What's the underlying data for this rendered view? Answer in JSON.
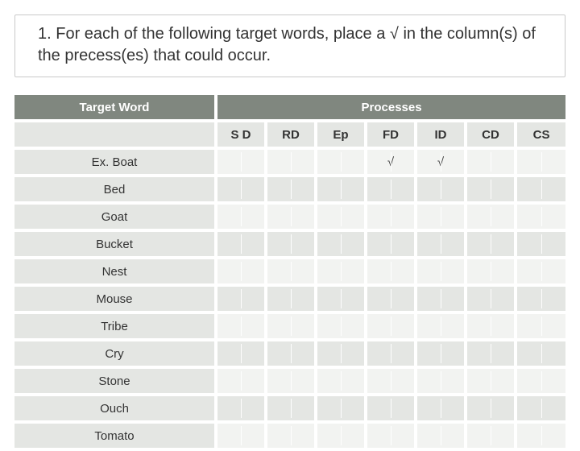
{
  "prompt": "1. For each of the following target words, place a √ in the column(s) of the precess(es) that could occur.",
  "headers": {
    "target_word": "Target Word",
    "processes": "Processes"
  },
  "process_columns": [
    "S D",
    "RD",
    "Ep",
    "FD",
    "ID",
    "CD",
    "CS"
  ],
  "check_mark": "√",
  "rows": [
    {
      "word": "Ex. Boat",
      "marks": [
        "",
        "",
        "",
        "√",
        "√",
        "",
        ""
      ]
    },
    {
      "word": "Bed",
      "marks": [
        "",
        "",
        "",
        "",
        "",
        "",
        ""
      ]
    },
    {
      "word": "Goat",
      "marks": [
        "",
        "",
        "",
        "",
        "",
        "",
        ""
      ]
    },
    {
      "word": "Bucket",
      "marks": [
        "",
        "",
        "",
        "",
        "",
        "",
        ""
      ]
    },
    {
      "word": "Nest",
      "marks": [
        "",
        "",
        "",
        "",
        "",
        "",
        ""
      ]
    },
    {
      "word": "Mouse",
      "marks": [
        "",
        "",
        "",
        "",
        "",
        "",
        ""
      ]
    },
    {
      "word": "Tribe",
      "marks": [
        "",
        "",
        "",
        "",
        "",
        "",
        ""
      ]
    },
    {
      "word": "Cry",
      "marks": [
        "",
        "",
        "",
        "",
        "",
        "",
        ""
      ]
    },
    {
      "word": "Stone",
      "marks": [
        "",
        "",
        "",
        "",
        "",
        "",
        ""
      ]
    },
    {
      "word": "Ouch",
      "marks": [
        "",
        "",
        "",
        "",
        "",
        "",
        ""
      ]
    },
    {
      "word": "Tomato",
      "marks": [
        "",
        "",
        "",
        "",
        "",
        "",
        ""
      ]
    }
  ]
}
